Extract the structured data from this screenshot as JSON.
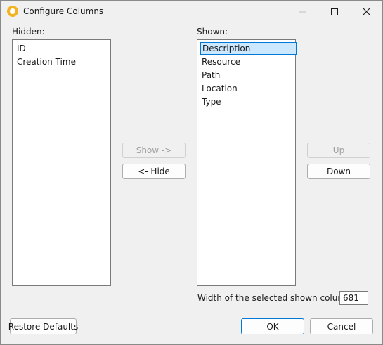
{
  "window": {
    "title": "Configure Columns",
    "app_icon": "app-icon"
  },
  "hidden": {
    "label": "Hidden:",
    "items": [
      "ID",
      "Creation Time"
    ]
  },
  "shown": {
    "label": "Shown:",
    "items": [
      "Description",
      "Resource",
      "Path",
      "Location",
      "Type"
    ],
    "selected_index": 0
  },
  "buttons": {
    "show": "Show ->",
    "hide": "<- Hide",
    "up": "Up",
    "down": "Down",
    "restore_defaults": "Restore Defaults",
    "ok": "OK",
    "cancel": "Cancel"
  },
  "width_field": {
    "label": "Width of the selected shown column:",
    "value": "681"
  },
  "colors": {
    "accent": "#0078d7",
    "selection": "#cce8ff",
    "app_icon": "#f2b320"
  }
}
